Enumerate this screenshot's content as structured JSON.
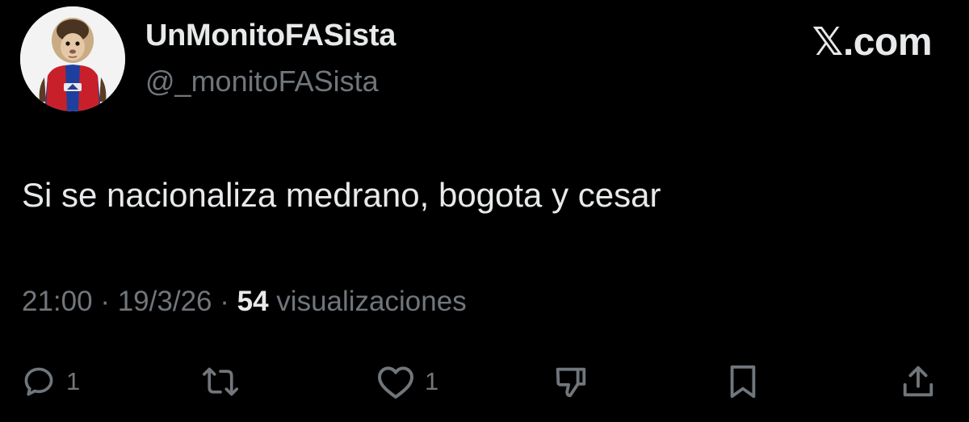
{
  "author": {
    "display_name": "UnMonitoFASista",
    "handle": "@_monitoFASista"
  },
  "brand": {
    "label": "𝕏.com"
  },
  "tweet": {
    "text": "Si se nacionaliza medrano, bogota y cesar",
    "time": "21:00",
    "separator": "·",
    "date": "19/3/26",
    "views_count": "54",
    "views_label": "visualizaciones"
  },
  "actions": {
    "reply": {
      "icon": "reply-icon",
      "count": "1"
    },
    "repost": {
      "icon": "repost-icon"
    },
    "like": {
      "icon": "heart-icon",
      "count": "1"
    },
    "dislike": {
      "icon": "dislike-icon"
    },
    "bookmark": {
      "icon": "bookmark-icon"
    },
    "share": {
      "icon": "share-icon"
    }
  },
  "colors": {
    "background": "#000000",
    "primary_text": "#e7e9ea",
    "secondary_text": "#71767b"
  }
}
